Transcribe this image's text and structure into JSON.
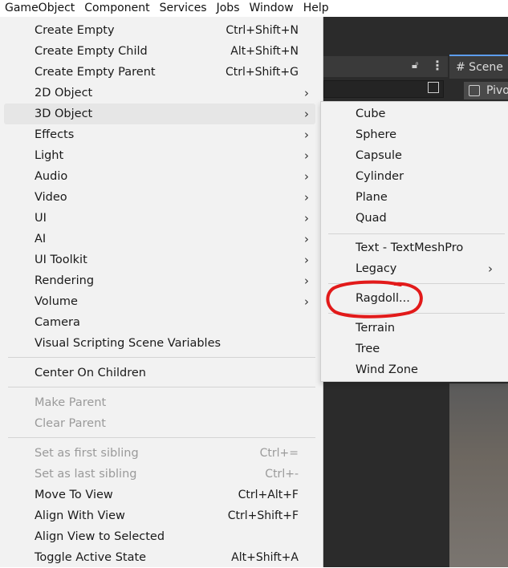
{
  "menubar": {
    "items": [
      "GameObject",
      "Component",
      "Services",
      "Jobs",
      "Window",
      "Help"
    ]
  },
  "editor": {
    "scene_tab": "# Scene",
    "pivot_label": "Pivo"
  },
  "main_menu": {
    "items": [
      {
        "label": "Create Empty",
        "shortcut": "Ctrl+Shift+N"
      },
      {
        "label": "Create Empty Child",
        "shortcut": "Alt+Shift+N"
      },
      {
        "label": "Create Empty Parent",
        "shortcut": "Ctrl+Shift+G"
      },
      {
        "label": "2D Object",
        "shortcut": "",
        "submenu": true
      },
      {
        "label": "3D Object",
        "shortcut": "",
        "submenu": true,
        "highlighted": true
      },
      {
        "label": "Effects",
        "shortcut": "",
        "submenu": true
      },
      {
        "label": "Light",
        "shortcut": "",
        "submenu": true
      },
      {
        "label": "Audio",
        "shortcut": "",
        "submenu": true
      },
      {
        "label": "Video",
        "shortcut": "",
        "submenu": true
      },
      {
        "label": "UI",
        "shortcut": "",
        "submenu": true
      },
      {
        "label": "AI",
        "shortcut": "",
        "submenu": true
      },
      {
        "label": "UI Toolkit",
        "shortcut": "",
        "submenu": true
      },
      {
        "label": "Rendering",
        "shortcut": "",
        "submenu": true
      },
      {
        "label": "Volume",
        "shortcut": "",
        "submenu": true
      },
      {
        "label": "Camera",
        "shortcut": ""
      },
      {
        "label": "Visual Scripting Scene Variables",
        "shortcut": ""
      },
      {
        "label": "Center On Children",
        "shortcut": ""
      },
      {
        "label": "Make Parent",
        "shortcut": "",
        "disabled": true
      },
      {
        "label": "Clear Parent",
        "shortcut": "",
        "disabled": true
      },
      {
        "label": "Set as first sibling",
        "shortcut": "Ctrl+=",
        "disabled": true
      },
      {
        "label": "Set as last sibling",
        "shortcut": "Ctrl+-",
        "disabled": true
      },
      {
        "label": "Move To View",
        "shortcut": "Ctrl+Alt+F"
      },
      {
        "label": "Align With View",
        "shortcut": "Ctrl+Shift+F"
      },
      {
        "label": "Align View to Selected",
        "shortcut": ""
      },
      {
        "label": "Toggle Active State",
        "shortcut": "Alt+Shift+A"
      }
    ]
  },
  "sub_menu": {
    "items": [
      {
        "label": "Cube"
      },
      {
        "label": "Sphere"
      },
      {
        "label": "Capsule"
      },
      {
        "label": "Cylinder"
      },
      {
        "label": "Plane"
      },
      {
        "label": "Quad"
      },
      {
        "label": "Text - TextMeshPro"
      },
      {
        "label": "Legacy",
        "submenu": true
      },
      {
        "label": "Ragdoll...",
        "annotated": true
      },
      {
        "label": "Terrain"
      },
      {
        "label": "Tree"
      },
      {
        "label": "Wind Zone"
      }
    ]
  },
  "annotation": {
    "color": "#e21a1a"
  },
  "colors": {
    "menu_bg": "#f2f2f2",
    "highlight": "#e6e6e6",
    "editor_dark": "#2b2b2b",
    "accent": "#5c9ded"
  }
}
